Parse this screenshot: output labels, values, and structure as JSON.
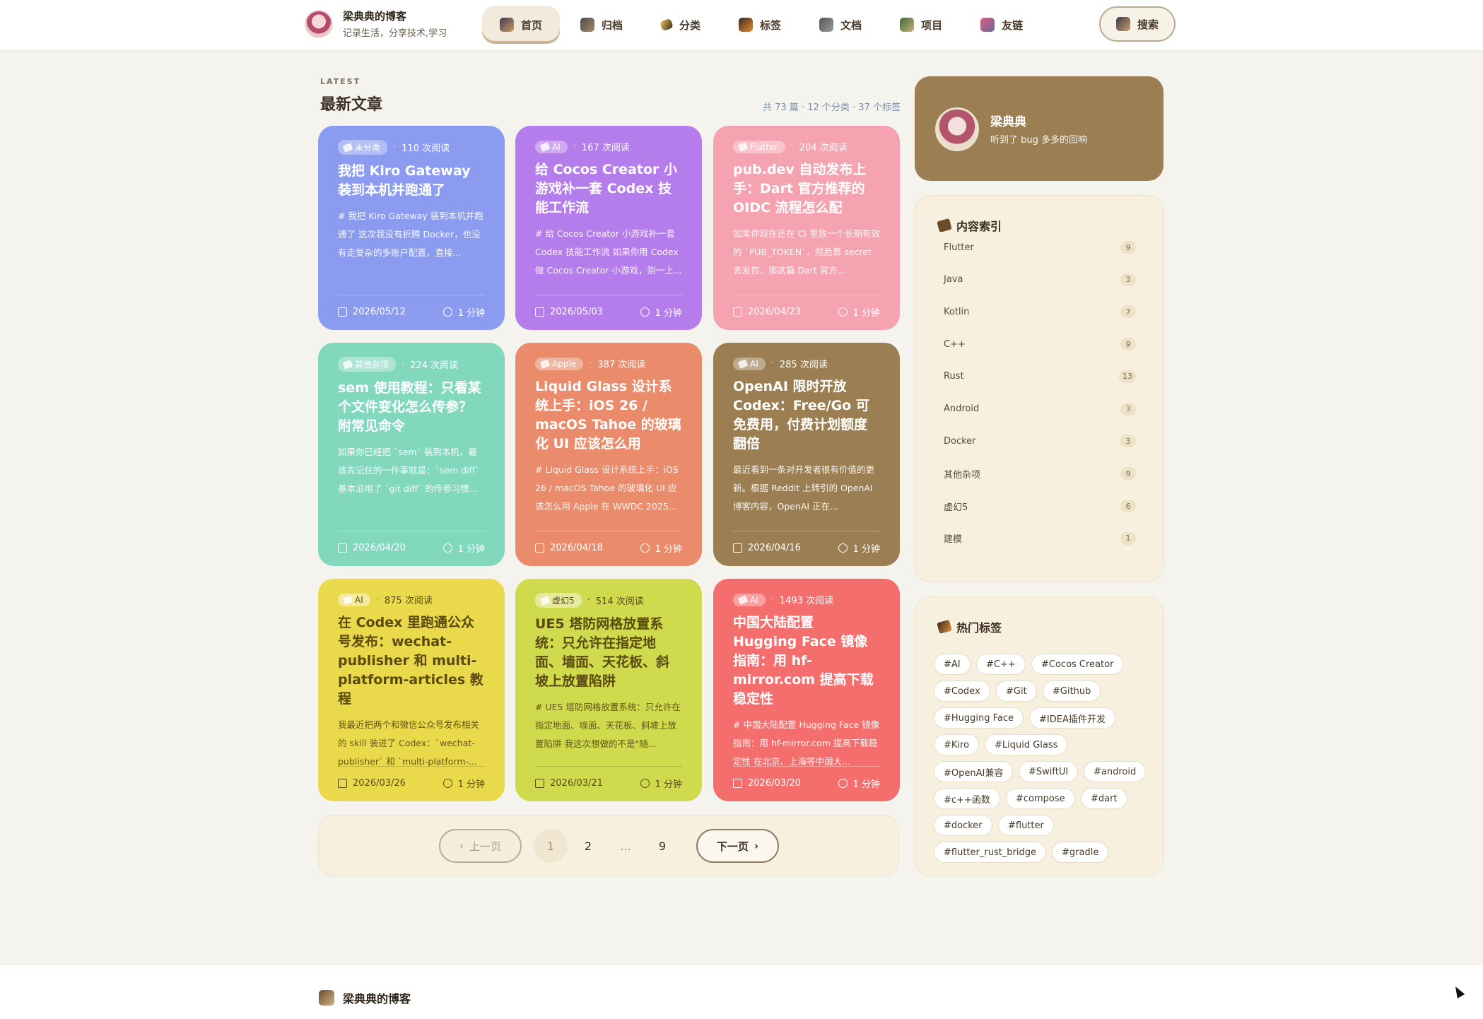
{
  "brand": {
    "title": "梁典典的博客",
    "subtitle": "记录生活，分享技术,学习"
  },
  "nav": [
    {
      "label": "首页",
      "icon": "home-icon",
      "active": true
    },
    {
      "label": "归档",
      "icon": "archive-icon"
    },
    {
      "label": "分类",
      "icon": "category-icon"
    },
    {
      "label": "标签",
      "icon": "tag-icon"
    },
    {
      "label": "文档",
      "icon": "docs-icon"
    },
    {
      "label": "项目",
      "icon": "project-icon"
    },
    {
      "label": "友链",
      "icon": "links-icon"
    }
  ],
  "search_label": "搜索",
  "section": {
    "kicker": "LATEST",
    "title": "最新文章",
    "meta": "共 73 篇 · 12 个分类 · 37 个标签"
  },
  "posts": [
    {
      "category": "未分类",
      "reads": "110 次阅读",
      "title": "我把 Kiro Gateway 装到本机并跑通了",
      "excerpt": "# 我把 Kiro Gateway 装到本机并跑通了 这次我没有折腾 Docker，也没有走复杂的多账户配置，直接...",
      "date": "2026/05/12",
      "time": "1 分钟",
      "color": "#8b9cf0"
    },
    {
      "category": "AI",
      "reads": "167 次阅读",
      "title": "给 Cocos Creator 小游戏补一套 Codex 技能工作流",
      "excerpt": "# 给 Cocos Creator 小游戏补一套 Codex 技能工作流 如果你用 Codex 做 Cocos Creator 小游戏，别一上...",
      "date": "2026/05/03",
      "time": "1 分钟",
      "color": "#b57cec"
    },
    {
      "category": "Flutter",
      "reads": "204 次阅读",
      "title": "pub.dev 自动发布上手：Dart 官方推荐的 OIDC 流程怎么配",
      "excerpt": "如果你现在还在 CI 里放一个长期有效的 `PUB_TOKEN`，然后靠 secret 去发包，那这篇 Dart 官方...",
      "date": "2026/04/23",
      "time": "1 分钟",
      "color": "#f5a3b0"
    },
    {
      "category": "其他杂项",
      "reads": "224 次阅读",
      "title": "sem 使用教程：只看某个文件变化怎么传参？附常见命令",
      "excerpt": "如果你已经把 `sem` 装到本机，最该先记住的一件事就是：`sem diff` 基本沿用了 `git diff` 的传参习惯...",
      "date": "2026/04/20",
      "time": "1 分钟",
      "color": "#82d8bd"
    },
    {
      "category": "Apple",
      "reads": "387 次阅读",
      "title": "Liquid Glass 设计系统上手：iOS 26 / macOS Tahoe 的玻璃化 UI 应该怎么用",
      "excerpt": "# Liquid Glass 设计系统上手：iOS 26 / macOS Tahoe 的玻璃化 UI 应该怎么用 Apple 在 WWDC 2025...",
      "date": "2026/04/18",
      "time": "1 分钟",
      "color": "#ea8c6c"
    },
    {
      "category": "AI",
      "reads": "285 次阅读",
      "title": "OpenAI 限时开放 Codex：Free/Go 可免费用，付费计划额度翻倍",
      "excerpt": "最近看到一条对开发者很有价值的更新。根据 Reddit 上转引的 OpenAI 博客内容，OpenAI 正在...",
      "date": "2026/04/16",
      "time": "1 分钟",
      "color": "#9b7f53"
    },
    {
      "category": "AI",
      "reads": "875 次阅读",
      "title": "在 Codex 里跑通公众号发布：wechat-publisher 和 multi-platform-articles 教程",
      "excerpt": "我最近把两个和微信公众号发布相关的 skill 装进了 Codex：`wechat-publisher` 和 `multi-platform-...",
      "date": "2026/03/26",
      "time": "1 分钟",
      "color": "#ebd94c"
    },
    {
      "category": "虚幻5",
      "reads": "514 次阅读",
      "title": "UE5 塔防网格放置系统：只允许在指定地面、墙面、天花板、斜坡上放置陷阱",
      "excerpt": "# UE5 塔防网格放置系统：只允许在指定地面、墙面、天花板、斜坡上放置陷阱 我这次想做的不是\"随...",
      "date": "2026/03/21",
      "time": "1 分钟",
      "color": "#cfdb4c"
    },
    {
      "category": "AI",
      "reads": "1493 次阅读",
      "title": "中国大陆配置 Hugging Face 镜像指南：用 hf-mirror.com 提高下载稳定性",
      "excerpt": "# 中国大陆配置 Hugging Face 镜像指南：用 hf-mirror.com 提高下载稳定性 在北京、上海等中国大...",
      "date": "2026/03/20",
      "time": "1 分钟",
      "color": "#f56e6e"
    }
  ],
  "pagination": {
    "prev": "上一页",
    "next": "下一页",
    "pages": [
      "1",
      "2",
      "...",
      "9"
    ],
    "current": "1"
  },
  "profile": {
    "name": "梁典典",
    "bio": "听到了 bug 多多的回响"
  },
  "index_panel": {
    "title": "内容索引",
    "items": [
      {
        "name": "Flutter",
        "count": "9"
      },
      {
        "name": "Java",
        "count": "3"
      },
      {
        "name": "Kotlin",
        "count": "7"
      },
      {
        "name": "C++",
        "count": "9"
      },
      {
        "name": "Rust",
        "count": "13"
      },
      {
        "name": "Android",
        "count": "3"
      },
      {
        "name": "Docker",
        "count": "3"
      },
      {
        "name": "其他杂项",
        "count": "9"
      },
      {
        "name": "虚幻5",
        "count": "6"
      },
      {
        "name": "建模",
        "count": "1"
      }
    ]
  },
  "tags_panel": {
    "title": "热门标签",
    "tags": [
      "#AI",
      "#C++",
      "#Cocos Creator",
      "#Codex",
      "#Git",
      "#Github",
      "#Hugging Face",
      "#IDEA插件开发",
      "#Kiro",
      "#Liquid Glass",
      "#OpenAI兼容",
      "#SwiftUI",
      "#android",
      "#c++函数",
      "#compose",
      "#dart",
      "#docker",
      "#flutter",
      "#flutter_rust_bridge",
      "#gradle"
    ]
  },
  "footer": {
    "brand": "梁典典的博客"
  }
}
